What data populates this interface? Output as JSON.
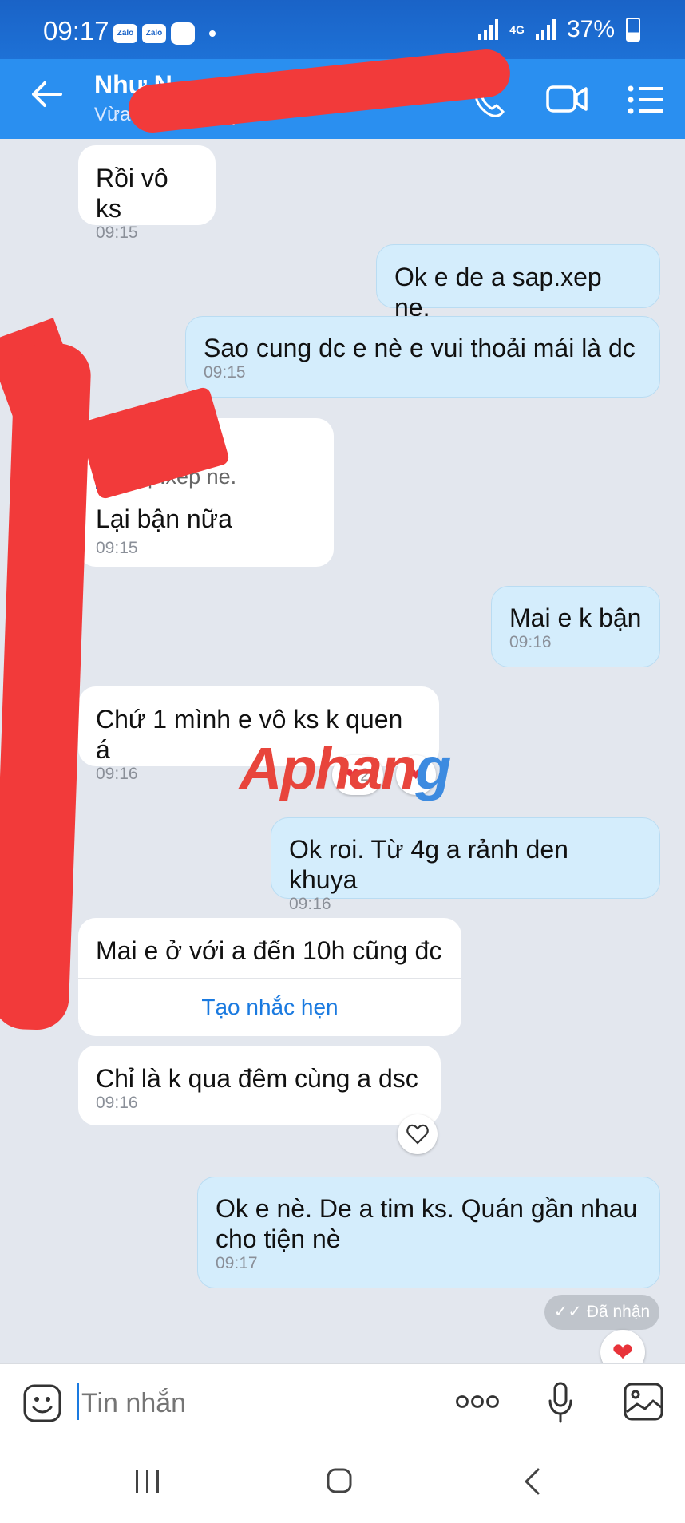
{
  "status_bar": {
    "time": "09:17",
    "app_badge_1": "Zalo",
    "app_badge_2": "Zalo",
    "network": "4G",
    "battery": "37%"
  },
  "header": {
    "contact_name": "Như N",
    "subtitle": "Vừa mới truy cập",
    "icons": [
      "back-arrow-icon",
      "phone-icon",
      "video-call-icon",
      "list-menu-icon"
    ]
  },
  "messages": [
    {
      "id": "m1",
      "direction": "in",
      "text": "Rồi vô ks",
      "time": "09:15"
    },
    {
      "id": "m2",
      "direction": "out",
      "text": "Ok e de a sap.xep ne.",
      "time": ""
    },
    {
      "id": "m3",
      "direction": "out",
      "text": "Sao cung dc e nè e vui thoải mái là dc",
      "time": "09:15"
    },
    {
      "id": "m4",
      "direction": "in",
      "quote": "a sap.xep ne.",
      "text": "Lại bận nữa",
      "time": "09:15"
    },
    {
      "id": "m5",
      "direction": "out",
      "text": "Mai e k bận",
      "time": "09:16"
    },
    {
      "id": "m6",
      "direction": "in",
      "text": "Chứ 1 mình e vô ks k quen á",
      "time": "09:16",
      "reaction_count": "2"
    },
    {
      "id": "m7",
      "direction": "out",
      "text": "Ok roi. Từ 4g a rảnh den khuya",
      "time": "09:16"
    },
    {
      "id": "m8",
      "direction": "in",
      "text": "Mai e ở với a đến 10h cũng đc",
      "action": "Tạo nhắc hẹn"
    },
    {
      "id": "m9",
      "direction": "in",
      "text": "Chỉ là k qua đêm cùng a dsc",
      "time": "09:16"
    },
    {
      "id": "m10",
      "direction": "out",
      "text_line1": "Ok e nè. De a tim ks. Quán gần nhau",
      "text_line2": "cho tiện nè",
      "time": "09:17"
    }
  ],
  "status": {
    "received": "Đã nhận"
  },
  "watermark": {
    "main": "Aphan",
    "tail": "g"
  },
  "input": {
    "placeholder": "Tin nhắn"
  },
  "colors": {
    "header": "#2a8ff0",
    "outgoing_bubble": "#d4edfc",
    "incoming_bubble": "#ffffff",
    "chat_bg": "#e3e7ee",
    "accent": "#1a7ae0",
    "heart": "#e8333a"
  }
}
